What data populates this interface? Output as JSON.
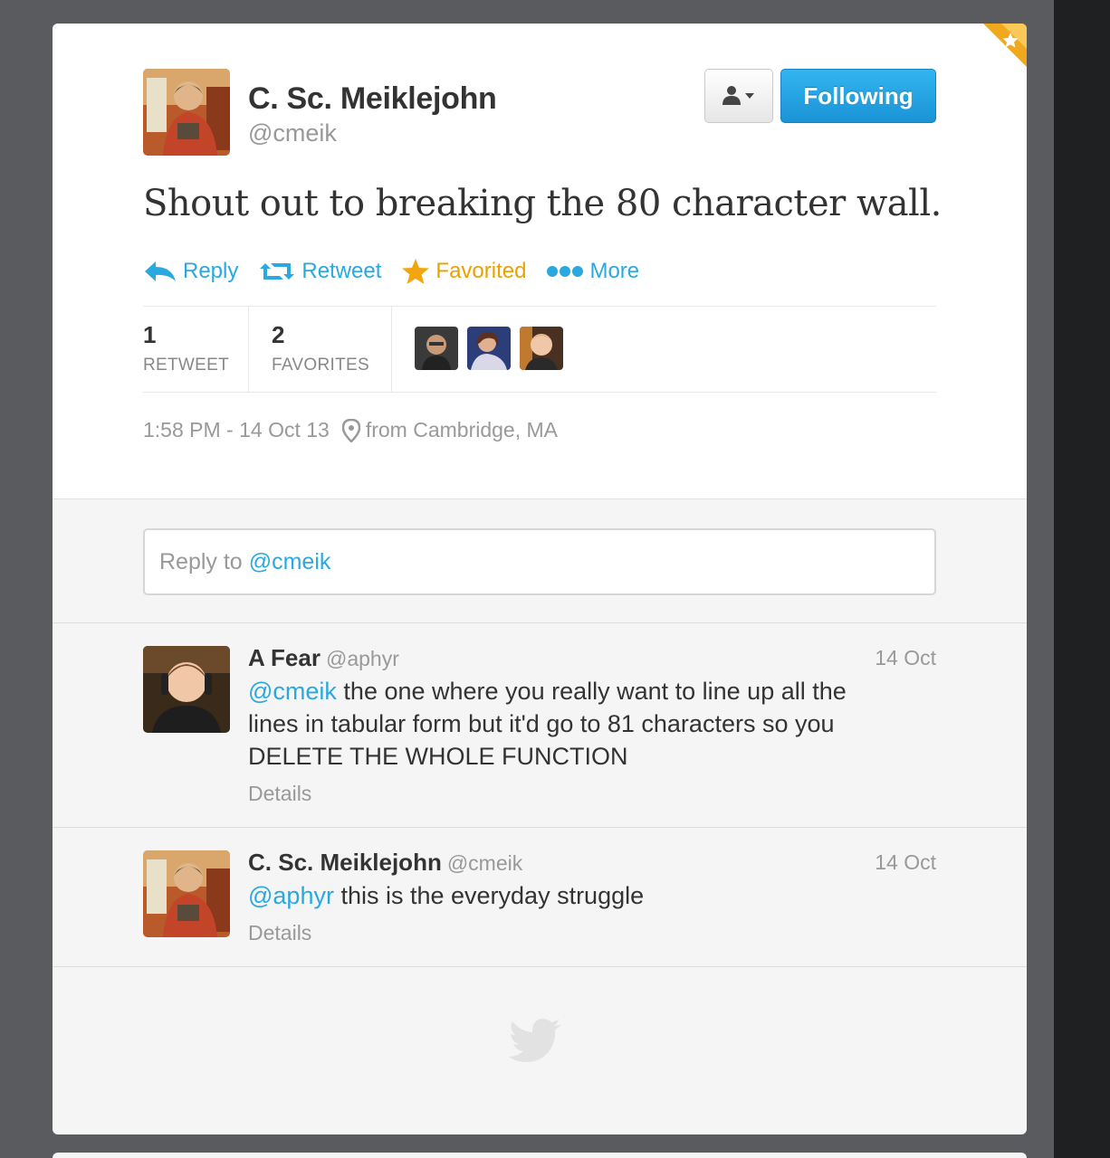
{
  "tweet": {
    "author_name": "C. Sc. Meiklejohn",
    "author_handle": "@cmeik",
    "follow_label": "Following",
    "text": "Shout out to breaking the 80 character wall.",
    "actions": {
      "reply": "Reply",
      "retweet": "Retweet",
      "favorited": "Favorited",
      "more": "More"
    },
    "stats": {
      "retweet_count": "1",
      "retweet_label": "RETWEET",
      "favorites_count": "2",
      "favorites_label": "FAVORITES"
    },
    "timestamp": "1:58 PM - 14 Oct 13",
    "location": "from Cambridge, MA"
  },
  "reply_box": {
    "prefix": "Reply to",
    "mention": "@cmeik"
  },
  "replies": [
    {
      "name": "A Fear",
      "handle": "@aphyr",
      "date": "14 Oct",
      "mention": "@cmeik",
      "text_line1": " the one where you really want to line up all the",
      "text_line2": "lines in tabular form but it'd go to 81 characters so you",
      "text_line3": "DELETE THE WHOLE FUNCTION",
      "details": "Details"
    },
    {
      "name": "C. Sc. Meiklejohn",
      "handle": "@cmeik",
      "date": "14 Oct",
      "mention": "@aphyr",
      "text": " this is the everyday struggle",
      "details": "Details"
    }
  ],
  "colors": {
    "link_blue": "#2aa9e0",
    "favorite_orange": "#e8a200",
    "follow_button": "#1a93d6"
  },
  "icons": [
    "star-corner-icon",
    "person-icon",
    "reply-icon",
    "retweet-icon",
    "star-icon",
    "more-dots-icon",
    "location-pin-icon",
    "twitter-bird-icon"
  ]
}
